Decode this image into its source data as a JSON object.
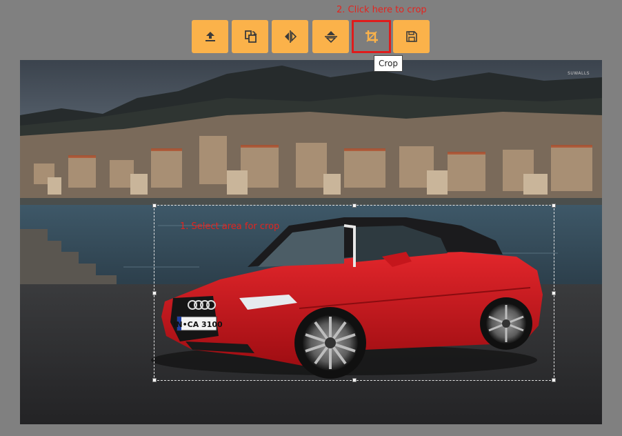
{
  "annotations": {
    "step2": "2. Click here to crop",
    "step1": "1. Select area for crop"
  },
  "toolbar": {
    "accent_color": "#fbb24a",
    "active_color": "#7d7d7d",
    "highlight_color": "#e01b1b",
    "buttons": [
      {
        "icon": "upload-icon"
      },
      {
        "icon": "rotate-icon"
      },
      {
        "icon": "flip-horizontal-icon"
      },
      {
        "icon": "flip-vertical-icon"
      },
      {
        "icon": "crop-icon",
        "active": true
      },
      {
        "icon": "save-icon"
      }
    ]
  },
  "tooltip": {
    "text": "Crop"
  },
  "image": {
    "watermark": "SUWALLS",
    "plate": "IN•CA 3100"
  }
}
